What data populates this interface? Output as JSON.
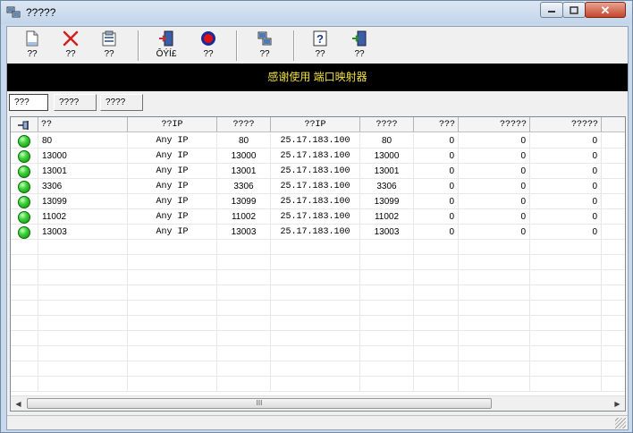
{
  "window": {
    "title": "?????"
  },
  "toolbar": {
    "buttons": [
      {
        "label": "??",
        "icon": "new-document-icon"
      },
      {
        "label": "??",
        "icon": "delete-x-icon"
      },
      {
        "label": "??",
        "icon": "properties-icon"
      },
      {
        "label": "ÔÝÍ£",
        "icon": "door-exit-icon"
      },
      {
        "label": "??",
        "icon": "stop-record-icon"
      },
      {
        "label": "??",
        "icon": "network-computer-icon"
      },
      {
        "label": "??",
        "icon": "help-icon"
      },
      {
        "label": "??",
        "icon": "exit-door-icon"
      }
    ]
  },
  "banner": {
    "text": "感谢使用 端口映射器",
    "color": "#f0e040"
  },
  "tabs": [
    {
      "label": "???",
      "active": true
    },
    {
      "label": "????",
      "active": false
    },
    {
      "label": "????",
      "active": false
    }
  ],
  "grid": {
    "header_icon": "pin-icon",
    "columns": [
      "??",
      "??IP",
      "????",
      "??IP",
      "????",
      "???",
      "?????",
      "?????"
    ],
    "rows": [
      {
        "status": "green",
        "c1": "80",
        "c2": "Any IP",
        "c3": "80",
        "c4": "25.17.183.100",
        "c5": "80",
        "c6": "0",
        "c7": "0",
        "c8": "0"
      },
      {
        "status": "green",
        "c1": "13000",
        "c2": "Any IP",
        "c3": "13000",
        "c4": "25.17.183.100",
        "c5": "13000",
        "c6": "0",
        "c7": "0",
        "c8": "0"
      },
      {
        "status": "green",
        "c1": "13001",
        "c2": "Any IP",
        "c3": "13001",
        "c4": "25.17.183.100",
        "c5": "13001",
        "c6": "0",
        "c7": "0",
        "c8": "0"
      },
      {
        "status": "green",
        "c1": "3306",
        "c2": "Any IP",
        "c3": "3306",
        "c4": "25.17.183.100",
        "c5": "3306",
        "c6": "0",
        "c7": "0",
        "c8": "0"
      },
      {
        "status": "green",
        "c1": "13099",
        "c2": "Any IP",
        "c3": "13099",
        "c4": "25.17.183.100",
        "c5": "13099",
        "c6": "0",
        "c7": "0",
        "c8": "0"
      },
      {
        "status": "green",
        "c1": "11002",
        "c2": "Any IP",
        "c3": "11002",
        "c4": "25.17.183.100",
        "c5": "11002",
        "c6": "0",
        "c7": "0",
        "c8": "0"
      },
      {
        "status": "green",
        "c1": "13003",
        "c2": "Any IP",
        "c3": "13003",
        "c4": "25.17.183.100",
        "c5": "13003",
        "c6": "0",
        "c7": "0",
        "c8": "0"
      }
    ]
  },
  "scrollbar": {
    "thumb_grip": "III"
  }
}
